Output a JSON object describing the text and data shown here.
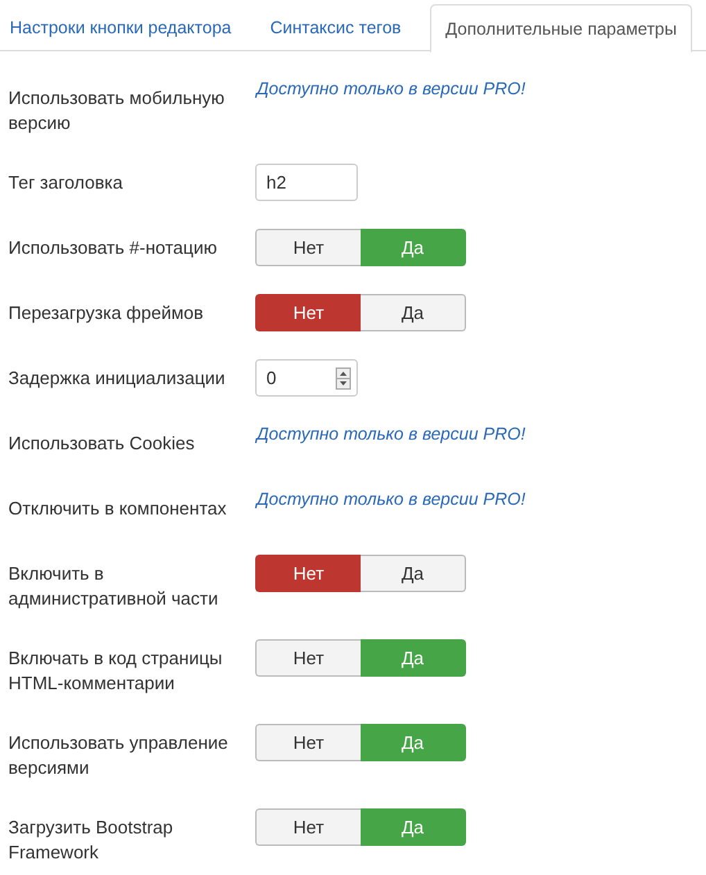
{
  "tabs": [
    {
      "label": "Настроки кнопки редактора",
      "selected": false
    },
    {
      "label": "Синтаксис тегов",
      "selected": false
    },
    {
      "label": "Дополнительные параметры",
      "selected": true
    }
  ],
  "fields": [
    {
      "kind": "pro",
      "label": "Использовать мобильную версию",
      "note": "Доступно только в версии PRO!"
    },
    {
      "kind": "text",
      "label": "Тег заголовка",
      "value": "h2"
    },
    {
      "kind": "toggle",
      "label": "Использовать #-нотацию",
      "options": [
        {
          "label": "Нет",
          "selected": false
        },
        {
          "label": "Да",
          "selected": true
        }
      ]
    },
    {
      "kind": "toggle",
      "label": "Перезагрузка фреймов",
      "options": [
        {
          "label": "Нет",
          "selected": true
        },
        {
          "label": "Да",
          "selected": false
        }
      ]
    },
    {
      "kind": "number",
      "label": "Задержка инициализации",
      "value": "0"
    },
    {
      "kind": "pro",
      "label": "Использовать Cookies",
      "note": "Доступно только в версии PRO!"
    },
    {
      "kind": "pro",
      "label": "Отключить в компонентах",
      "note": "Доступно только в версии PRO!"
    },
    {
      "kind": "toggle",
      "label": "Включить в административной части",
      "options": [
        {
          "label": "Нет",
          "selected": true
        },
        {
          "label": "Да",
          "selected": false
        }
      ]
    },
    {
      "kind": "toggle",
      "label": "Включать в код страницы HTML-комментарии",
      "options": [
        {
          "label": "Нет",
          "selected": false
        },
        {
          "label": "Да",
          "selected": true
        }
      ]
    },
    {
      "kind": "toggle",
      "label": "Использовать управление версиями",
      "options": [
        {
          "label": "Нет",
          "selected": false
        },
        {
          "label": "Да",
          "selected": true
        }
      ]
    },
    {
      "kind": "toggle",
      "label": "Загрузить Bootstrap Framework",
      "options": [
        {
          "label": "Нет",
          "selected": false
        },
        {
          "label": "Да",
          "selected": true
        }
      ]
    }
  ]
}
